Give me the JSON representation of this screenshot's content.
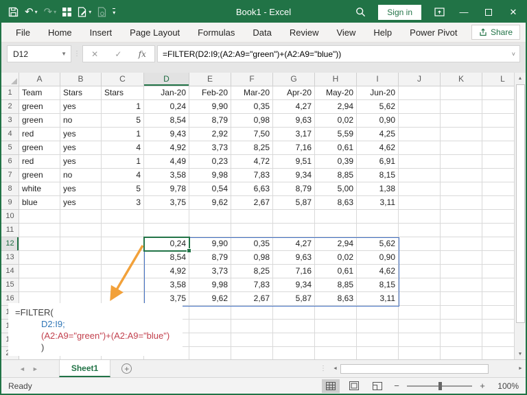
{
  "titlebar": {
    "title": "Book1  -  Excel",
    "sign_in_label": "Sign in"
  },
  "ribbon": {
    "tabs": [
      "File",
      "Home",
      "Insert",
      "Page Layout",
      "Formulas",
      "Data",
      "Review",
      "View",
      "Help",
      "Power Pivot"
    ],
    "share_label": "Share"
  },
  "formula_bar": {
    "name_box": "D12",
    "fx_label": "fx",
    "formula": "=FILTER(D2:I9;(A2:A9=\"green\")+(A2:A9=\"blue\"))"
  },
  "sheet": {
    "columns": [
      "A",
      "B",
      "C",
      "D",
      "E",
      "F",
      "G",
      "H",
      "I",
      "J",
      "K",
      "L"
    ],
    "selected_column": "D",
    "selected_row": 12,
    "active_cell": "D12",
    "rows": {
      "1": [
        "Team",
        "Stars",
        "Stars",
        "Jan-20",
        "Feb-20",
        "Mar-20",
        "Apr-20",
        "May-20",
        "Jun-20"
      ],
      "2": [
        "green",
        "yes",
        "1",
        "0,24",
        "9,90",
        "0,35",
        "4,27",
        "2,94",
        "5,62"
      ],
      "3": [
        "green",
        "no",
        "5",
        "8,54",
        "8,79",
        "0,98",
        "9,63",
        "0,02",
        "0,90"
      ],
      "4": [
        "red",
        "yes",
        "1",
        "9,43",
        "2,92",
        "7,50",
        "3,17",
        "5,59",
        "4,25"
      ],
      "5": [
        "green",
        "yes",
        "4",
        "4,92",
        "3,73",
        "8,25",
        "7,16",
        "0,61",
        "4,62"
      ],
      "6": [
        "red",
        "yes",
        "1",
        "4,49",
        "0,23",
        "4,72",
        "9,51",
        "0,39",
        "6,91"
      ],
      "7": [
        "green",
        "no",
        "4",
        "3,58",
        "9,98",
        "7,83",
        "9,34",
        "8,85",
        "8,15"
      ],
      "8": [
        "white",
        "yes",
        "5",
        "9,78",
        "0,54",
        "6,63",
        "8,79",
        "5,00",
        "1,38"
      ],
      "9": [
        "blue",
        "yes",
        "3",
        "3,75",
        "9,62",
        "2,67",
        "5,87",
        "8,63",
        "3,11"
      ],
      "12": [
        "",
        "",
        "",
        "0,24",
        "9,90",
        "0,35",
        "4,27",
        "2,94",
        "5,62"
      ],
      "13": [
        "",
        "",
        "",
        "8,54",
        "8,79",
        "0,98",
        "9,63",
        "0,02",
        "0,90"
      ],
      "14": [
        "",
        "",
        "",
        "4,92",
        "3,73",
        "8,25",
        "7,16",
        "0,61",
        "4,62"
      ],
      "15": [
        "",
        "",
        "",
        "3,58",
        "9,98",
        "7,83",
        "9,34",
        "8,85",
        "8,15"
      ],
      "16": [
        "",
        "",
        "",
        "3,75",
        "9,62",
        "2,67",
        "5,87",
        "8,63",
        "3,11"
      ]
    },
    "callout": {
      "lines": [
        {
          "text": "=FILTER(",
          "color": "#404040",
          "indent": 0
        },
        {
          "text": "D2:I9;",
          "color": "#2e75b6",
          "indent": 1
        },
        {
          "text": "(A2:A9=\"green\")+(A2:A9=\"blue\")",
          "color": "#c2404d",
          "indent": 1
        },
        {
          "text": ")",
          "color": "#404040",
          "indent": 1
        }
      ]
    },
    "colors": {
      "accent_green": "#217346",
      "spill_border_blue": "#4472c4",
      "arrow_orange": "#f2a13a"
    }
  },
  "tabbar": {
    "sheet_name": "Sheet1"
  },
  "statusbar": {
    "ready_label": "Ready",
    "zoom_level": "100%"
  }
}
